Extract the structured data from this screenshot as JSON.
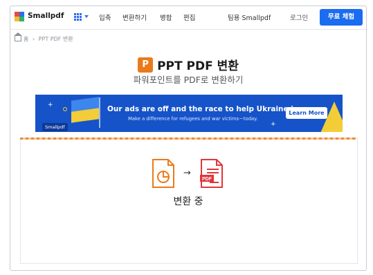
{
  "header": {
    "brand": "Smallpdf",
    "nav": [
      "입축",
      "변환하기",
      "병합",
      "편집"
    ],
    "team": "팀용 Smallpdf",
    "login": "로그인",
    "free_trial": "무료 체험"
  },
  "breadcrumb": {
    "home": "홈",
    "sep": "›",
    "current": "PPT PDF 변환"
  },
  "title": {
    "icon_letter": "P",
    "text": "PPT PDF 변환",
    "subtitle": "파워포인트를 PDF로 변환하기"
  },
  "banner": {
    "headline": "Our ads are off and the race to help Ukraine is on",
    "subline": "Make a difference for refugees and war victims—today.",
    "button": "Learn More",
    "badge": "Smallpdf"
  },
  "conversion": {
    "status": "변환 중",
    "from_icon": "ppt-file-icon",
    "to_icon": "pdf-file-icon",
    "to_label": "PDF"
  },
  "colors": {
    "accent": "#1a6cf0",
    "ppt_orange": "#ea7a1a",
    "pdf_red": "#e0353a",
    "banner_blue": "#1653c9",
    "flag_yellow": "#f2cd38"
  }
}
